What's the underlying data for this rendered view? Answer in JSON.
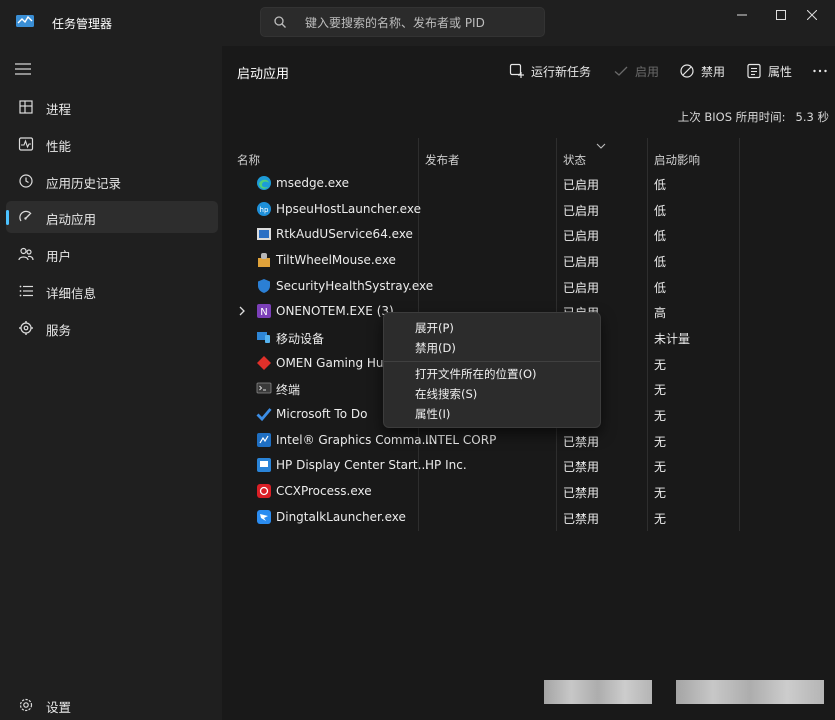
{
  "app": {
    "title": "任务管理器",
    "search_placeholder": "键入要搜索的名称、发布者或 PID"
  },
  "sidebar": {
    "items": [
      {
        "label": "进程",
        "icon": "processes-icon"
      },
      {
        "label": "性能",
        "icon": "performance-icon"
      },
      {
        "label": "应用历史记录",
        "icon": "history-icon"
      },
      {
        "label": "启动应用",
        "icon": "startup-icon",
        "active": true
      },
      {
        "label": "用户",
        "icon": "users-icon"
      },
      {
        "label": "详细信息",
        "icon": "details-icon"
      },
      {
        "label": "服务",
        "icon": "services-icon"
      }
    ],
    "settings_label": "设置"
  },
  "toolbar": {
    "page_title": "启动应用",
    "run_new_task": "运行新任务",
    "enable": "启用",
    "disable": "禁用",
    "properties": "属性"
  },
  "bios": {
    "label": "上次 BIOS 所用时间:",
    "value": "5.3 秒"
  },
  "table": {
    "columns": [
      "名称",
      "发布者",
      "状态",
      "启动影响"
    ],
    "rows": [
      {
        "name": "msedge.exe",
        "publisher": "",
        "status": "已启用",
        "impact": "低",
        "icon": "edge-icon"
      },
      {
        "name": "HpseuHostLauncher.exe",
        "publisher": "",
        "status": "已启用",
        "impact": "低",
        "icon": "hp-icon"
      },
      {
        "name": "RtkAudUService64.exe",
        "publisher": "",
        "status": "已启用",
        "impact": "低",
        "icon": "realtek-audio-icon"
      },
      {
        "name": "TiltWheelMouse.exe",
        "publisher": "",
        "status": "已启用",
        "impact": "低",
        "icon": "mouse-app-icon"
      },
      {
        "name": "SecurityHealthSystray.exe",
        "publisher": "",
        "status": "已启用",
        "impact": "低",
        "icon": "shield-icon"
      },
      {
        "name": "ONENOTEM.EXE (3)",
        "publisher": "",
        "status": "已启用",
        "impact": "高",
        "icon": "onenote-icon"
      },
      {
        "name": "移动设备",
        "publisher": "",
        "status": "",
        "impact": "未计量",
        "icon": "mobile-devices-icon"
      },
      {
        "name": "OMEN Gaming Hub",
        "publisher": "",
        "status": "",
        "impact": "无",
        "icon": "omen-icon"
      },
      {
        "name": "终端",
        "publisher": "",
        "status": "",
        "impact": "无",
        "icon": "terminal-icon"
      },
      {
        "name": "Microsoft To Do",
        "publisher": "",
        "status": "",
        "impact": "无",
        "icon": "todo-icon"
      },
      {
        "name": "Intel® Graphics Comma...",
        "publisher": "INTEL CORP",
        "status": "已禁用",
        "impact": "无",
        "icon": "intel-graphics-icon"
      },
      {
        "name": "HP Display Center Start...",
        "publisher": "HP Inc.",
        "status": "已禁用",
        "impact": "无",
        "icon": "hp-display-icon"
      },
      {
        "name": "CCXProcess.exe",
        "publisher": "",
        "status": "已禁用",
        "impact": "无",
        "icon": "creative-cloud-icon"
      },
      {
        "name": "DingtalkLauncher.exe",
        "publisher": "",
        "status": "已禁用",
        "impact": "无",
        "icon": "dingtalk-icon"
      }
    ]
  },
  "context_menu": {
    "items": [
      "展开(P)",
      "禁用(D)",
      "打开文件所在的位置(O)",
      "在线搜索(S)",
      "属性(I)"
    ]
  },
  "colors": {
    "accent": "#4cc2ff",
    "background": "#1c1c1c",
    "sidebar": "#1f1f1f"
  }
}
